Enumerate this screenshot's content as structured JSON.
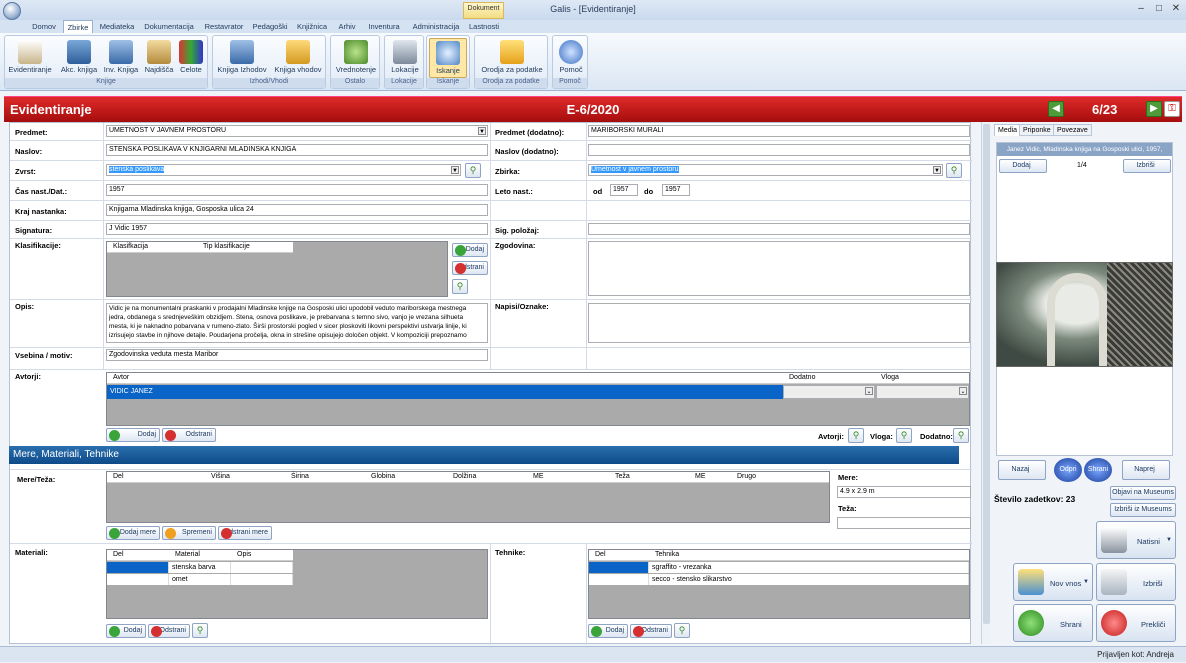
{
  "window": {
    "title": "Galis - [Evidentiranje]",
    "context_tab": "Dokument"
  },
  "menu": [
    "Domov",
    "Zbirke",
    "Mediateka",
    "Dokumentacija",
    "Restavrator",
    "Pedagoški",
    "Knjižnica",
    "Arhiv",
    "Inventura",
    "Administracija",
    "Lastnosti"
  ],
  "ribbon": {
    "groups": [
      "Knjige",
      "Izhodi/Vhodi",
      "Ostalo",
      "Lokacije",
      "Iskanje",
      "Orodja za podatke",
      "Pomoč"
    ],
    "buttons": [
      "Evidentiranje",
      "Akc. knjiga",
      "Inv. Knjiga",
      "Najdišča",
      "Celote",
      "Knjiga Izhodov",
      "Knjiga vhodov",
      "Vrednotenje",
      "Lokacije",
      "Iskanje",
      "Orodja za podatke",
      "Pomoč"
    ]
  },
  "header": {
    "title": "Evidentiranje",
    "code": "E-6/2020",
    "page": "6/23"
  },
  "form": {
    "predmet_label": "Predmet:",
    "predmet": "UMETNOST V JAVNEM PROSTORU",
    "predmet_dod_label": "Predmet (dodatno):",
    "predmet_dod": "MARIBORSKI MURALI",
    "naslov_label": "Naslov:",
    "naslov": "STENSKA POSLIKAVA V KNJIGARNI MLADINSKA KNJIGA",
    "naslov_dod_label": "Naslov (dodatno):",
    "naslov_dod": "",
    "zvrst_label": "Zvrst:",
    "zvrst": "stenska poslikava",
    "zbirka_label": "Zbirka:",
    "zbirka": "Umetnost v javnem prostoru",
    "cas_label": "Čas nast./Dat.:",
    "cas": "1957",
    "leto_label": "Leto nast.:",
    "od_label": "od",
    "od": "1957",
    "do_label": "do",
    "do": "1957",
    "kraj_label": "Kraj nastanka:",
    "kraj": "Knjigarna Mladinska knjiga, Gosposka ulica 24",
    "signatura_label": "Signatura:",
    "signatura": "J Vidic 1957",
    "sig_polozaj_label": "Sig. položaj:",
    "sig_polozaj": "",
    "klasifikacije_label": "Klasifikacije:",
    "klas_cols": [
      "Klasifkacija",
      "Tip klasifikacije"
    ],
    "zgodovina_label": "Zgodovina:",
    "opis_label": "Opis:",
    "opis": "Vidic je na monumentalni praskanki v prodajalni Mladinske knjige na Gosposki ulici upodobil veduto mariborskega mestnega jedra, obdanega s srednjeveškim obzidjem. Stena, osnova poslikave, je prebarvana s temno sivo, vanjo je vrezana silhueta mesta, ki je naknadno pobarvana v rumeno-zlato. Širši prostorski pogled v sicer ploskoviti likovni perspektivi ustvarja linije, ki izrisujejo stavbe in njihove detajle. Poudarjena pročelja, okna in strešine opisujejo določen objekt. V kompoziciji prepoznamo",
    "napisi_label": "Napisi/Oznake:",
    "vsebina_label": "Vsebina / motiv:",
    "vsebina": "Zgodovinska veduta mesta Maribor",
    "avtorji_label": "Avtorji:",
    "avt_cols": [
      "Avtor",
      "Dodatno",
      "Vloga"
    ],
    "avtor": "VIDIC JANEZ",
    "avtorji2": "Avtorji:",
    "vloga": "Vloga:",
    "dodatno": "Dodatno:",
    "section": "Mere, Materiali, Tehnike",
    "mere_label": "Mere/Teža:",
    "mere_cols": [
      "Del",
      "Višina",
      "Širina",
      "Globina",
      "Dolžina",
      "ME",
      "Teža",
      "ME",
      "Drugo"
    ],
    "mere_side": "Mere:",
    "mere_val": "4.9 x 2.9 m",
    "teza": "Teža:",
    "teza_val": "",
    "materiali_label": "Materiali:",
    "mat_cols": [
      "Del",
      "Material",
      "Opis"
    ],
    "mat_rows": [
      "stenska barva",
      "omet"
    ],
    "tehnike_label": "Tehnike:",
    "teh_cols": [
      "Del",
      "Tehnika"
    ],
    "teh_rows": [
      "sgraffito - vrezanka",
      "secco - stensko slikarstvo"
    ]
  },
  "buttons": {
    "dodaj": "Dodaj",
    "odstrani": "Odstrani",
    "dodaj_mere": "Dodaj mere",
    "spremeni": "Spremeni",
    "odstrani_mere": "Odstrani mere",
    "odstrani_short": "Odstrani",
    "dodaj_klas": "Dodaj",
    "odstrani_klas": "Odstrani"
  },
  "right": {
    "tabs": [
      "Media",
      "Priponke",
      "Povezave"
    ],
    "caption": "Janez Vidic, Mladinska knjiga na Gosposki ulici, 1957,",
    "dodaj": "Dodaj",
    "counter": "1/4",
    "izbrisi": "Izbriši",
    "nazaj": "Nazaj",
    "odpri": "Odpri",
    "shrani": "Shrani",
    "naprej": "Naprej",
    "stevilo": "Število zadetkov: 23",
    "objavi": "Objavi na Museums",
    "izbrisi_mus": "Izbriši iz Museums",
    "natisni": "Natisni",
    "nov_vnos": "Nov vnos",
    "izbrisi_big": "Izbriši",
    "shrani_big": "Shrani",
    "preklici": "Prekliči"
  },
  "status": "Prijavljen kot: Andreja"
}
